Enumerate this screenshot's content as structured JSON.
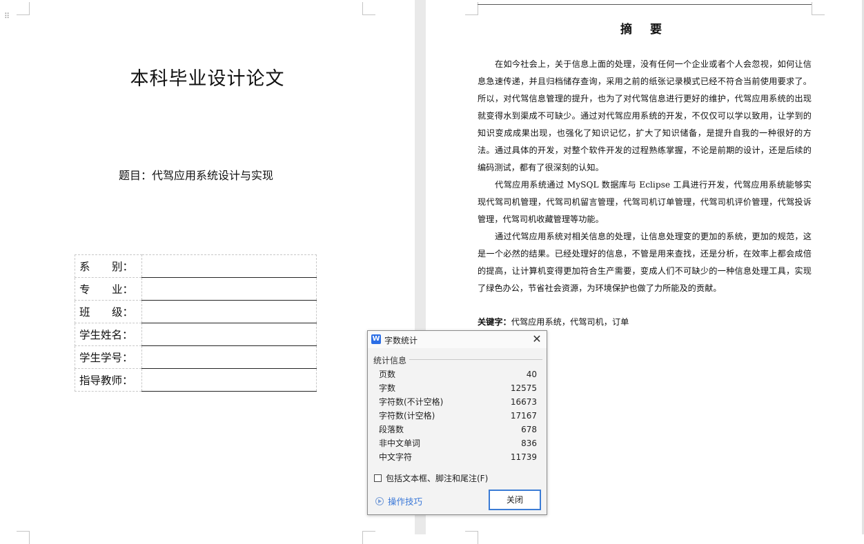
{
  "cover": {
    "title": "本科毕业设计论文",
    "subject": "题目：代驾应用系统设计与实现",
    "fields": [
      {
        "label_parts": [
          "系",
          "别："
        ],
        "label": "",
        "value": ""
      },
      {
        "label_parts": [
          "专",
          "业："
        ],
        "label": "",
        "value": ""
      },
      {
        "label_parts": [
          "班",
          "级："
        ],
        "label": "",
        "value": ""
      },
      {
        "label_parts": [],
        "label": "学生姓名：",
        "value": ""
      },
      {
        "label_parts": [],
        "label": "学生学号：",
        "value": ""
      },
      {
        "label_parts": [],
        "label": "指导教师：",
        "value": ""
      }
    ]
  },
  "abstract": {
    "title": "摘  要",
    "paragraphs": [
      "在如今社会上，关于信息上面的处理，没有任何一个企业或者个人会忽视，如何让信息急速传递，并且归档储存查询，采用之前的纸张记录模式已经不符合当前使用要求了。所以，对代驾信息管理的提升，也为了对代驾信息进行更好的维护，代驾应用系统的出现就变得水到渠成不可缺少。通过对代驾应用系统的开发，不仅仅可以学以致用，让学到的知识变成成果出现，也强化了知识记忆，扩大了知识储备，是提升自我的一种很好的方法。通过具体的开发，对整个软件开发的过程熟练掌握，不论是前期的设计，还是后续的编码测试，都有了很深刻的认知。",
      "代驾应用系统通过 MySQL 数据库与 Eclipse 工具进行开发，代驾应用系统能够实现代驾司机管理，代驾司机留言管理，代驾司机订单管理，代驾司机评价管理，代驾投诉管理，代驾司机收藏管理等功能。",
      "通过代驾应用系统对相关信息的处理，让信息处理变的更加的系统，更加的规范，这是一个必然的结果。已经处理好的信息，不管是用来查找，还是分析，在效率上都会成倍的提高，让计算机变得更加符合生产需要，变成人们不可缺少的一种信息处理工具，实现了绿色办公，节省社会资源，为环境保护也做了力所能及的贡献。"
    ],
    "keywords_label": "关键字：",
    "keywords": "代驾应用系统，代驾司机，订单"
  },
  "dialog": {
    "logo": "W",
    "title": "字数统计",
    "group_label": "统计信息",
    "stats": [
      {
        "label": "页数",
        "value": "40"
      },
      {
        "label": "字数",
        "value": "12575"
      },
      {
        "label": "字符数(不计空格)",
        "value": "16673"
      },
      {
        "label": "字符数(计空格)",
        "value": "17167"
      },
      {
        "label": "段落数",
        "value": "678"
      },
      {
        "label": "非中文单词",
        "value": "836"
      },
      {
        "label": "中文字符",
        "value": "11739"
      }
    ],
    "checkbox_label": "包括文本框、脚注和尾注(F)",
    "checkbox_checked": false,
    "tips_label": "操作技巧",
    "close_label": "关闭",
    "close_glyph": "✕"
  }
}
